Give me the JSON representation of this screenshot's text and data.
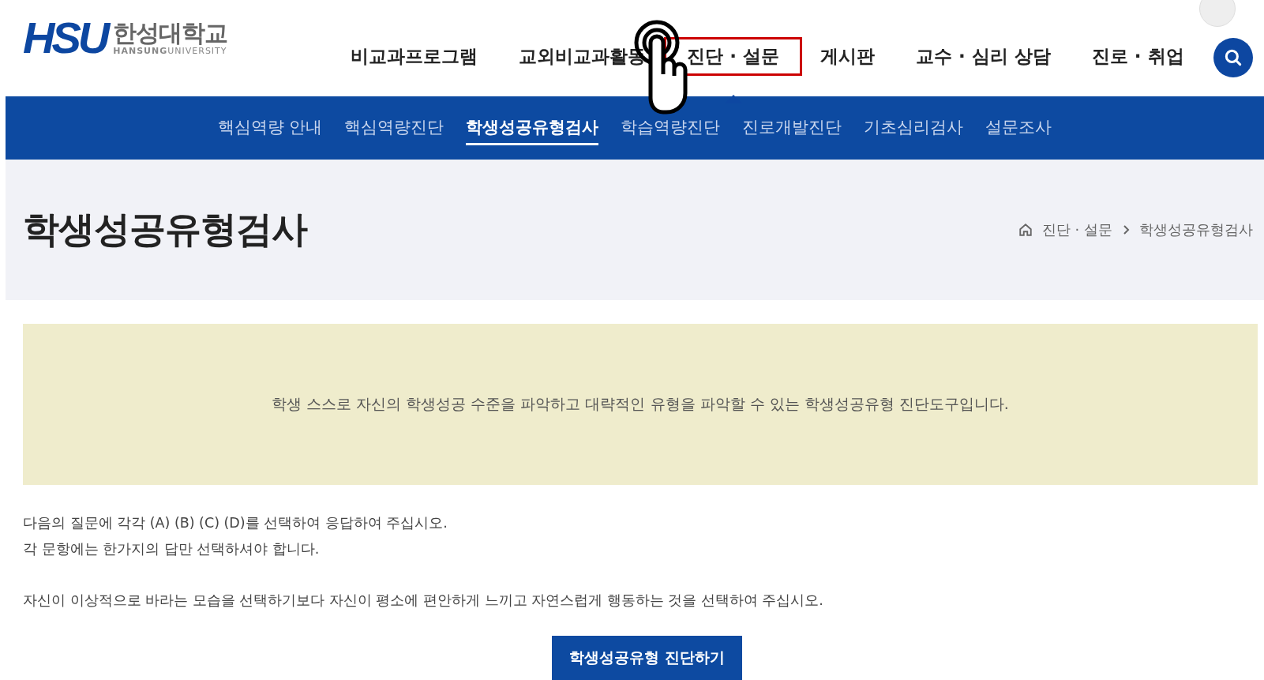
{
  "logo": {
    "mark": "HSU",
    "name": "한성대학교",
    "sub_bold": "HANSUNG",
    "sub": "UNIVERSITY"
  },
  "main_nav": [
    {
      "label": "비교과프로그램",
      "selected": false
    },
    {
      "label": "교외비교과활동",
      "selected": false
    },
    {
      "label": "진단 · 설문",
      "selected": true
    },
    {
      "label": "게시판",
      "selected": false
    },
    {
      "label": "교수 · 심리 상담",
      "selected": false
    },
    {
      "label": "진로 · 취업",
      "selected": false
    }
  ],
  "sub_nav": [
    {
      "label": "핵심역량 안내",
      "selected": false
    },
    {
      "label": "핵심역량진단",
      "selected": false
    },
    {
      "label": "학생성공유형검사",
      "selected": true
    },
    {
      "label": "학습역량진단",
      "selected": false
    },
    {
      "label": "진로개발진단",
      "selected": false
    },
    {
      "label": "기초심리검사",
      "selected": false
    },
    {
      "label": "설문조사",
      "selected": false
    }
  ],
  "page_title": "학생성공유형검사",
  "breadcrumb": [
    "진단 · 설문",
    "학생성공유형검사"
  ],
  "notice": "학생 스스로 자신의 학생성공 수준을 파악하고 대략적인 유형을 파악할 수 있는 학생성공유형 진단도구입니다.",
  "instructions": [
    "다음의 질문에 각각 (A) (B) (C) (D)를 선택하여 응답하여 주십시오.",
    "각 문항에는 한가지의 답만 선택하셔야 합니다."
  ],
  "instruction_note": "자신이 이상적으로 바라는 모습을 선택하기보다 자신이 평소에 편안하게 느끼고 자연스럽게 행동하는 것을 선택하여 주십시오.",
  "start_button": "학생성공유형 진단하기"
}
